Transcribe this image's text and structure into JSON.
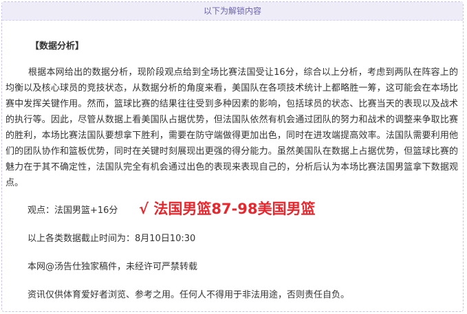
{
  "banner": {
    "text": "以下为解锁内容"
  },
  "heading": "【数据分析】",
  "paragraph": "根据本网给出的数据分析，现阶段观点给到全场比赛法国受让16分，综合以上分析，考虑到两队在阵容上的均衡以及核心球员的竞技状态，从数据分析的角度来看，美国队在各项技术统计上都略胜一筹，这可能会在本场比赛中发挥关键作用。然而，篮球比赛的结果往往受到多种因素的影响，包括球员的状态、比赛当天的表现以及战术的执行等。因此，尽管从数据上看美国队占据优势，但法国队依然有机会通过团队的努力和战术的调整来争取比赛的胜利，本场比赛法国队要想拿下胜利，需要在防守端做得更加出色，同时在进攻端提高效率。法国队需要利用他们的团队协作和篮板优势，同时在关键时刻展现出更强的得分能力。虽然美国队在数据上占据优势，但篮球比赛的魅力在于其不确定性，法国队完全有机会通过出色的表现来表现自己的，分析后认为本场比赛法国男篮拿下数据观点。",
  "viewpoint": {
    "label": "观点：法国男篮+16分",
    "result": "√ 法国男篮87-98美国男篮"
  },
  "cutoff": "以上各类数据截止时间为：8月10日10:30",
  "copyright": "本网@汤告仕独家稿件，未经许可严禁转载",
  "disclaimer": "资讯仅供体育爱好者浏览、参考之用。任何人不得用于非法用途，否则责任自负。",
  "colors": {
    "accent": "#e8262d",
    "banner_bg": "#eeedf7",
    "banner_text": "#6b62b0"
  }
}
